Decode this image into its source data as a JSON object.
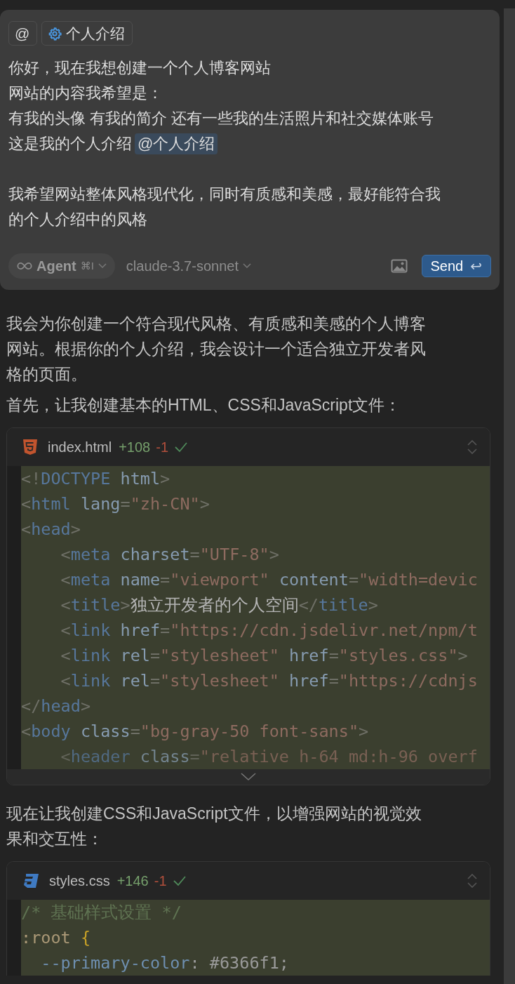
{
  "composer": {
    "context_chips": [
      {
        "kind": "at",
        "label": "@"
      },
      {
        "kind": "rule",
        "label": "个人介绍"
      }
    ],
    "paragraphs": [
      [
        {
          "text": "你好，现在我想创建一个个人博客网站"
        },
        {
          "text": "网站的内容我希望是："
        },
        {
          "text": "有我的头像 有我的简介 还有一些我的生活照片和社交媒体账号"
        },
        {
          "text": "这是我的个人介绍",
          "mention": "@个人介绍"
        }
      ],
      [
        {
          "text": "我希望网站整体风格现代化，同时有质感和美感，最好能符合我"
        },
        {
          "text": "的个人介绍中的风格"
        }
      ]
    ],
    "mode": {
      "label": "Agent",
      "shortcut": "⌘I"
    },
    "model": "claude-3.7-sonnet",
    "send": {
      "label": "Send",
      "key": "↩"
    }
  },
  "response": [
    {
      "kind": "text",
      "lines": [
        "我会为你创建一个符合现代风格、有质感和美感的个人博客",
        "网站。根据你的个人介绍，我会设计一个适合独立开发者风",
        "格的页面。"
      ]
    },
    {
      "kind": "text",
      "lines": [
        "首先，让我创建基本的HTML、CSS和JavaScript文件："
      ]
    },
    {
      "kind": "code_html",
      "filename": "index.html",
      "added": "+108",
      "removed": "-1",
      "applied": true,
      "collapsed": true,
      "lines": [
        {
          "tokens": [
            {
              "kind": "punct",
              "t": "<!"
            },
            {
              "kind": "tag",
              "t": "DOCTYPE"
            },
            {
              "kind": "attr",
              "t": " html"
            },
            {
              "kind": "punct",
              "t": ">"
            }
          ]
        },
        {
          "tokens": [
            {
              "kind": "punct",
              "t": "<"
            },
            {
              "kind": "tag",
              "t": "html"
            },
            {
              "kind": "attr",
              "t": " lang"
            },
            {
              "kind": "punct",
              "t": "="
            },
            {
              "kind": "str",
              "t": "\"zh-CN\""
            },
            {
              "kind": "punct",
              "t": ">"
            }
          ]
        },
        {
          "tokens": [
            {
              "kind": "punct",
              "t": "<"
            },
            {
              "kind": "tag",
              "t": "head"
            },
            {
              "kind": "punct",
              "t": ">"
            }
          ]
        },
        {
          "tokens": [
            {
              "kind": "punct",
              "t": "    <"
            },
            {
              "kind": "tag",
              "t": "meta"
            },
            {
              "kind": "attr",
              "t": " charset"
            },
            {
              "kind": "punct",
              "t": "="
            },
            {
              "kind": "str",
              "t": "\"UTF-8\""
            },
            {
              "kind": "punct",
              "t": ">"
            }
          ]
        },
        {
          "tokens": [
            {
              "kind": "punct",
              "t": "    <"
            },
            {
              "kind": "tag",
              "t": "meta"
            },
            {
              "kind": "attr",
              "t": " name"
            },
            {
              "kind": "punct",
              "t": "="
            },
            {
              "kind": "str",
              "t": "\"viewport\""
            },
            {
              "kind": "attr",
              "t": " content"
            },
            {
              "kind": "punct",
              "t": "="
            },
            {
              "kind": "str",
              "t": "\"width=devic"
            }
          ]
        },
        {
          "tokens": [
            {
              "kind": "punct",
              "t": "    <"
            },
            {
              "kind": "tag",
              "t": "title"
            },
            {
              "kind": "punct",
              "t": ">"
            },
            {
              "kind": "text",
              "t": "独立开发者的个人空间"
            },
            {
              "kind": "punct",
              "t": "</"
            },
            {
              "kind": "tag",
              "t": "title"
            },
            {
              "kind": "punct",
              "t": ">"
            }
          ]
        },
        {
          "tokens": [
            {
              "kind": "punct",
              "t": "    <"
            },
            {
              "kind": "tag",
              "t": "link"
            },
            {
              "kind": "attr",
              "t": " href"
            },
            {
              "kind": "punct",
              "t": "="
            },
            {
              "kind": "str",
              "t": "\"https://cdn.jsdelivr.net/npm/t"
            }
          ]
        },
        {
          "tokens": [
            {
              "kind": "punct",
              "t": "    <"
            },
            {
              "kind": "tag",
              "t": "link"
            },
            {
              "kind": "attr",
              "t": " rel"
            },
            {
              "kind": "punct",
              "t": "="
            },
            {
              "kind": "str",
              "t": "\"stylesheet\""
            },
            {
              "kind": "attr",
              "t": " href"
            },
            {
              "kind": "punct",
              "t": "="
            },
            {
              "kind": "str",
              "t": "\"styles.css\""
            },
            {
              "kind": "punct",
              "t": ">"
            }
          ]
        },
        {
          "tokens": [
            {
              "kind": "punct",
              "t": "    <"
            },
            {
              "kind": "tag",
              "t": "link"
            },
            {
              "kind": "attr",
              "t": " rel"
            },
            {
              "kind": "punct",
              "t": "="
            },
            {
              "kind": "str",
              "t": "\"stylesheet\""
            },
            {
              "kind": "attr",
              "t": " href"
            },
            {
              "kind": "punct",
              "t": "="
            },
            {
              "kind": "str",
              "t": "\"https://cdnjs"
            }
          ]
        },
        {
          "tokens": [
            {
              "kind": "punct",
              "t": "</"
            },
            {
              "kind": "tag",
              "t": "head"
            },
            {
              "kind": "punct",
              "t": ">"
            }
          ]
        },
        {
          "tokens": [
            {
              "kind": "punct",
              "t": "<"
            },
            {
              "kind": "tag",
              "t": "body"
            },
            {
              "kind": "attr",
              "t": " class"
            },
            {
              "kind": "punct",
              "t": "="
            },
            {
              "kind": "str",
              "t": "\"bg-gray-50 font-sans\""
            },
            {
              "kind": "punct",
              "t": ">"
            }
          ]
        },
        {
          "tokens": [
            {
              "kind": "punct",
              "t": "    <"
            },
            {
              "kind": "tag",
              "t": "header"
            },
            {
              "kind": "attr",
              "t": " class"
            },
            {
              "kind": "punct",
              "t": "="
            },
            {
              "kind": "str",
              "t": "\"relative h-64 md:h-96 overf"
            }
          ]
        }
      ]
    },
    {
      "kind": "text",
      "lines": [
        "现在让我创建CSS和JavaScript文件，以增强网站的视觉效",
        "果和交互性："
      ]
    },
    {
      "kind": "code_css",
      "filename": "styles.css",
      "added": "+146",
      "removed": "-1",
      "applied": true,
      "collapsed": false,
      "lines": [
        {
          "tokens": [
            {
              "kind": "comment",
              "t": "/* 基础样式设置 */"
            }
          ]
        },
        {
          "tokens": [
            {
              "kind": "sel",
              "t": ":root"
            },
            {
              "kind": "brace",
              "t": " {"
            }
          ]
        },
        {
          "tokens": [
            {
              "kind": "prop",
              "t": "  --primary-color"
            },
            {
              "kind": "val",
              "t": ": #6366f1;"
            }
          ]
        }
      ]
    }
  ]
}
